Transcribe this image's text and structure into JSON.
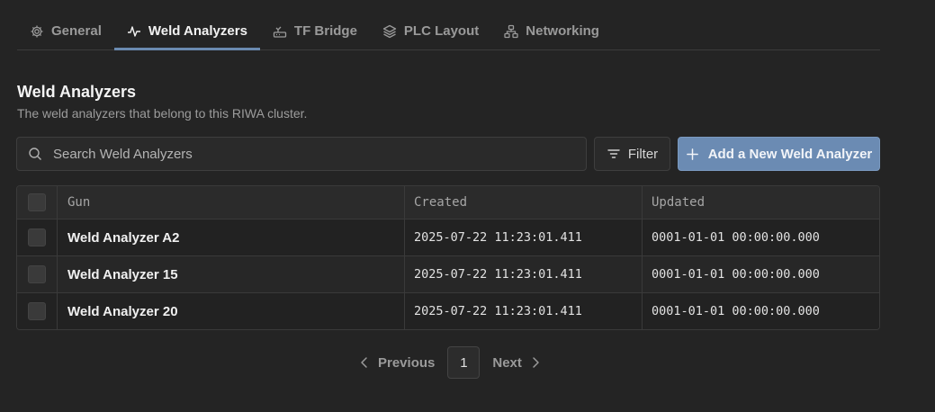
{
  "tabs": [
    {
      "label": "General",
      "icon": "gear-icon",
      "active": false
    },
    {
      "label": "Weld Analyzers",
      "icon": "activity-icon",
      "active": true
    },
    {
      "label": "TF Bridge",
      "icon": "router-icon",
      "active": false
    },
    {
      "label": "PLC Layout",
      "icon": "layers-icon",
      "active": false
    },
    {
      "label": "Networking",
      "icon": "network-icon",
      "active": false
    }
  ],
  "section": {
    "title": "Weld Analyzers",
    "description": "The weld analyzers that belong to this RIWA cluster."
  },
  "search": {
    "placeholder": "Search Weld Analyzers",
    "value": ""
  },
  "toolbar": {
    "filter_label": "Filter",
    "add_label": "Add a New Weld Analyzer"
  },
  "table": {
    "columns": [
      "Gun",
      "Created",
      "Updated"
    ],
    "rows": [
      {
        "gun": "Weld Analyzer A2",
        "created": "2025-07-22 11:23:01.411",
        "updated": "0001-01-01 00:00:00.000"
      },
      {
        "gun": "Weld Analyzer 15",
        "created": "2025-07-22 11:23:01.411",
        "updated": "0001-01-01 00:00:00.000"
      },
      {
        "gun": "Weld Analyzer 20",
        "created": "2025-07-22 11:23:01.411",
        "updated": "0001-01-01 00:00:00.000"
      }
    ]
  },
  "pagination": {
    "previous_label": "Previous",
    "current_page": "1",
    "next_label": "Next"
  },
  "colors": {
    "accent": "#6b8bb3",
    "background": "#242424"
  }
}
